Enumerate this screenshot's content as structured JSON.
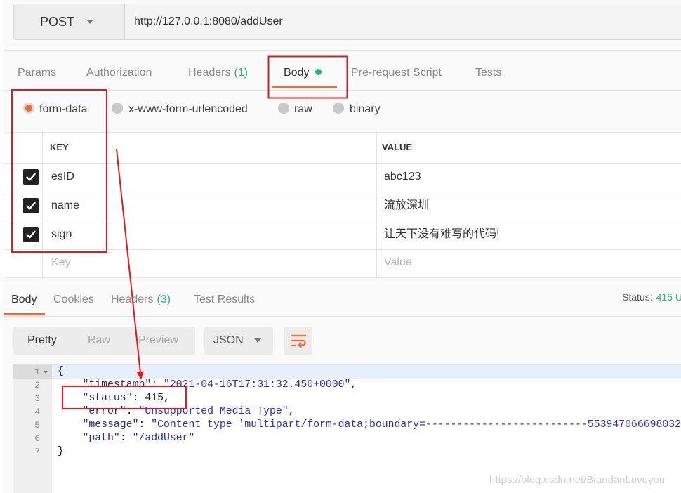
{
  "request": {
    "method": "POST",
    "url": "http://127.0.0.1:8080/addUser"
  },
  "request_tabs": [
    {
      "label": "Params"
    },
    {
      "label": "Authorization"
    },
    {
      "label": "Headers",
      "count": "(1)"
    },
    {
      "label": "Body",
      "active": true,
      "has_indicator_dot": true
    },
    {
      "label": "Pre-request Script"
    },
    {
      "label": "Tests"
    }
  ],
  "body_modes": [
    {
      "label": "form-data",
      "selected": true
    },
    {
      "label": "x-www-form-urlencoded",
      "selected": false
    },
    {
      "label": "raw",
      "selected": false
    },
    {
      "label": "binary",
      "selected": false
    }
  ],
  "form_table": {
    "columns": [
      "KEY",
      "VALUE"
    ],
    "rows": [
      {
        "checked": true,
        "key": "esID",
        "value": "abc123"
      },
      {
        "checked": true,
        "key": "name",
        "value": "流放深圳"
      },
      {
        "checked": true,
        "key": "sign",
        "value": "让天下没有难写的代码!"
      }
    ],
    "new_row": {
      "key_placeholder": "Key",
      "value_placeholder": "Value"
    }
  },
  "response": {
    "tabs": [
      {
        "label": "Body",
        "active": true
      },
      {
        "label": "Cookies"
      },
      {
        "label": "Headers",
        "count": "(3)"
      },
      {
        "label": "Test Results"
      }
    ],
    "status_label": "Status:",
    "status_value": "415 U",
    "view_modes": [
      {
        "label": "Pretty",
        "active": true
      },
      {
        "label": "Raw"
      },
      {
        "label": "Preview"
      }
    ],
    "format": "JSON",
    "code_lines": [
      {
        "n": "1",
        "fold": true,
        "highlighted": true,
        "text": "{"
      },
      {
        "n": "2",
        "text": "    \"timestamp\": \"2021-04-16T17:31:32.450+0000\","
      },
      {
        "n": "3",
        "text": "    \"status\": 415,"
      },
      {
        "n": "4",
        "text": "    \"error\": \"Unsupported Media Type\","
      },
      {
        "n": "5",
        "text": "    \"message\": \"Content type 'multipart/form-data;boundary=--------------------------553947066698032"
      },
      {
        "n": "6",
        "text": "    \"path\": \"/addUser\""
      },
      {
        "n": "7",
        "text": "}"
      }
    ]
  },
  "icons": {
    "method_dropdown": "chevron-down-icon",
    "format_dropdown": "chevron-down-icon",
    "row_checkbox": "check-icon",
    "wrap_button": "wrap-lines-icon",
    "code_fold": "fold-chevron-icon"
  },
  "watermark": "https://blog.csdn.net/BiandanLoveyou",
  "colors": {
    "accent": "#f26b3a",
    "success_green": "#26b47f",
    "checkbox": "#222222",
    "annotation_red": "#e3191c",
    "json_key": "#2b2b80",
    "json_string": "#2a2ad1"
  }
}
